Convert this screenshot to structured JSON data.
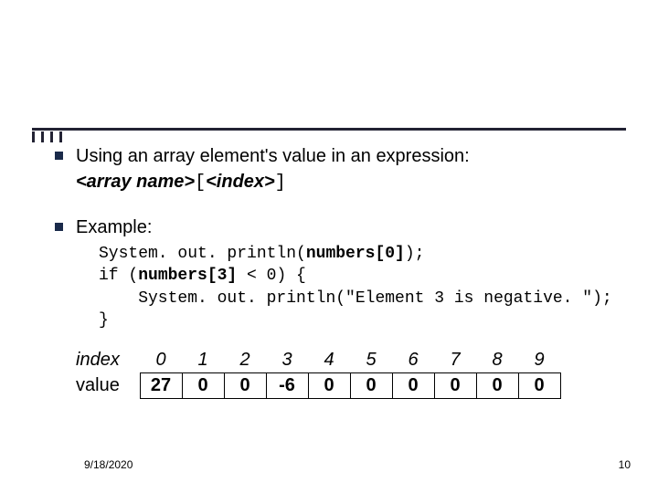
{
  "bullet1": "Using an array element's value in an expression:",
  "syntax": {
    "arrname": "<array name>",
    "lbr": "[",
    "index": "<index>",
    "rbr": "]"
  },
  "bullet2": "Example:",
  "code": {
    "l1a": "System. out. println(",
    "l1b": "numbers[0]",
    "l1c": ");",
    "l2a": "if (",
    "l2b": "numbers[3]",
    "l2c": " < 0) {",
    "l3": "    System. out. println(\"Element 3 is negative. \");",
    "l4": "}"
  },
  "table": {
    "indexLabel": "index",
    "valueLabel": "value",
    "indices": [
      "0",
      "1",
      "2",
      "3",
      "4",
      "5",
      "6",
      "7",
      "8",
      "9"
    ],
    "values": [
      "27",
      "0",
      "0",
      "-6",
      "0",
      "0",
      "0",
      "0",
      "0",
      "0"
    ]
  },
  "footer": {
    "date": "9/18/2020",
    "page": "10"
  }
}
